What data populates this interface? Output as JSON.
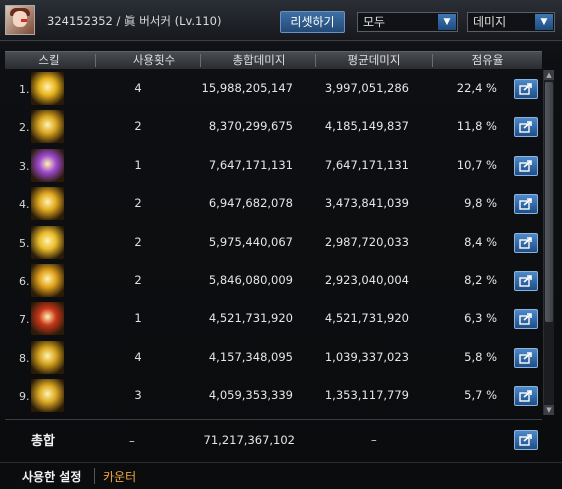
{
  "header": {
    "player": "324152352 / 眞 버서커 (Lv.110)",
    "reset_label": "리셋하기",
    "filter_target": "모두",
    "filter_metric": "데미지"
  },
  "columns": [
    "스킬",
    "사용횟수",
    "총합데미지",
    "평균데미지",
    "점유율"
  ],
  "rows": [
    {
      "num": "1.",
      "count": "4",
      "total": "15,988,205,147",
      "avg": "3,997,051,286",
      "share": "22,4 %",
      "icon": "golden-burst-icon",
      "color": "#e6b21c"
    },
    {
      "num": "2.",
      "count": "2",
      "total": "8,370,299,675",
      "avg": "4,185,149,837",
      "share": "11,8 %",
      "icon": "golden-slash-icon",
      "color": "#d9a520"
    },
    {
      "num": "3.",
      "count": "1",
      "total": "7,647,171,131",
      "avg": "7,647,171,131",
      "share": "10,7 %",
      "icon": "purple-demon-icon",
      "color": "#a04ad0"
    },
    {
      "num": "4.",
      "count": "2",
      "total": "6,947,682,078",
      "avg": "3,473,841,039",
      "share": "9,8 %",
      "icon": "golden-flame-icon",
      "color": "#e0a81e"
    },
    {
      "num": "5.",
      "count": "2",
      "total": "5,975,440,067",
      "avg": "2,987,720,033",
      "share": "8,4 %",
      "icon": "golden-star-icon",
      "color": "#e8bb2a"
    },
    {
      "num": "6.",
      "count": "2",
      "total": "5,846,080,009",
      "avg": "2,923,040,004",
      "share": "8,2 %",
      "icon": "golden-eruption-icon",
      "color": "#e0a11c"
    },
    {
      "num": "7.",
      "count": "1",
      "total": "4,521,731,920",
      "avg": "4,521,731,920",
      "share": "6,3 %",
      "icon": "red-beast-icon",
      "color": "#c8361a"
    },
    {
      "num": "8.",
      "count": "4",
      "total": "4,157,348,095",
      "avg": "1,039,337,023",
      "share": "5,8 %",
      "icon": "golden-swirl-icon",
      "color": "#d6a31e"
    },
    {
      "num": "9.",
      "count": "3",
      "total": "4,059,353,339",
      "avg": "1,353,117,779",
      "share": "5,7 %",
      "icon": "golden-wave-icon",
      "color": "#dba822"
    }
  ],
  "total": {
    "label": "총합",
    "count": "–",
    "total": "71,217,367,102",
    "avg": "–"
  },
  "tabs": {
    "active": "사용한 설정",
    "other": "카운터"
  },
  "colors": {
    "accent": "#2f5f96",
    "tab_highlight": "#f0a73b"
  }
}
